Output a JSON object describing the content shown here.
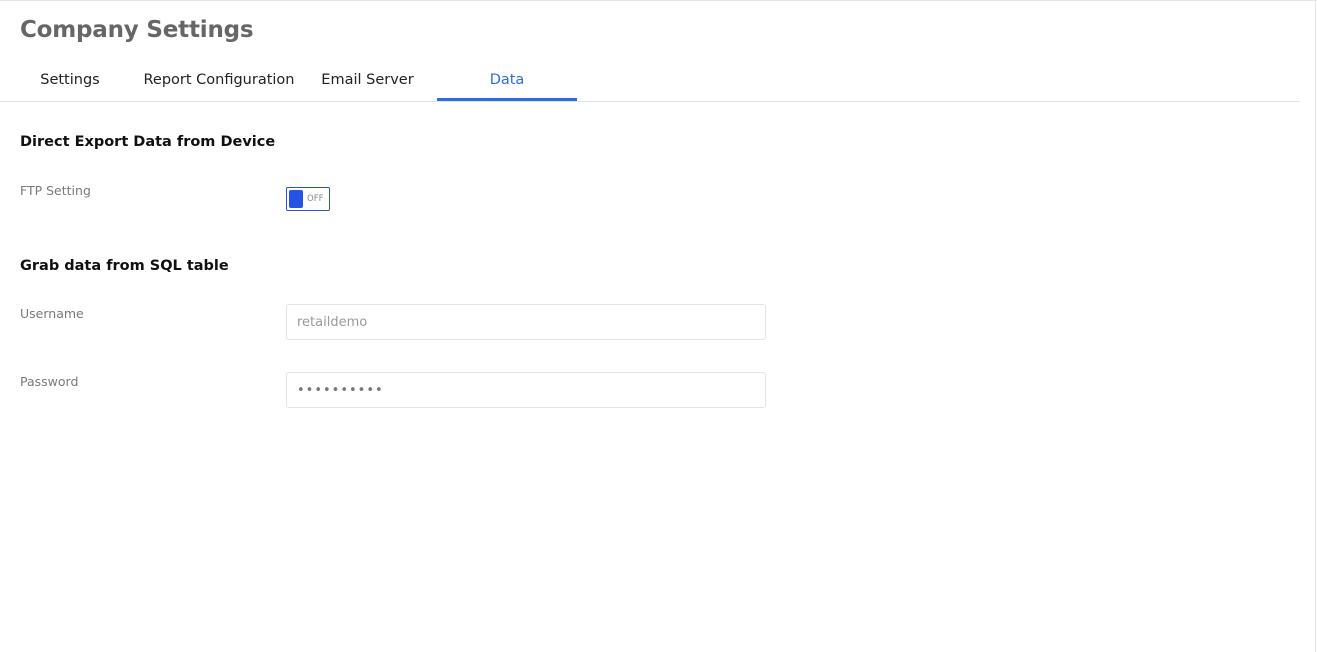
{
  "page": {
    "title": "Company Settings"
  },
  "tabs": [
    {
      "label": "Settings",
      "active": false
    },
    {
      "label": "Report Configuration",
      "active": false
    },
    {
      "label": "Email Server",
      "active": false
    },
    {
      "label": "Data",
      "active": true
    }
  ],
  "export_section": {
    "heading": "Direct Export Data from Device",
    "ftp_label": "FTP Setting",
    "ftp_toggle": {
      "state_text": "OFF",
      "enabled": false
    }
  },
  "sql_section": {
    "heading": "Grab data from SQL table",
    "username_label": "Username",
    "username_value": "retaildemo",
    "password_label": "Password",
    "password_value": "••••••••••"
  },
  "colors": {
    "accent": "#2b6de6",
    "toggle_knob": "#2553e6",
    "title_text": "#666666",
    "label_text": "#7a7a7a",
    "border": "#e3e3e3"
  }
}
